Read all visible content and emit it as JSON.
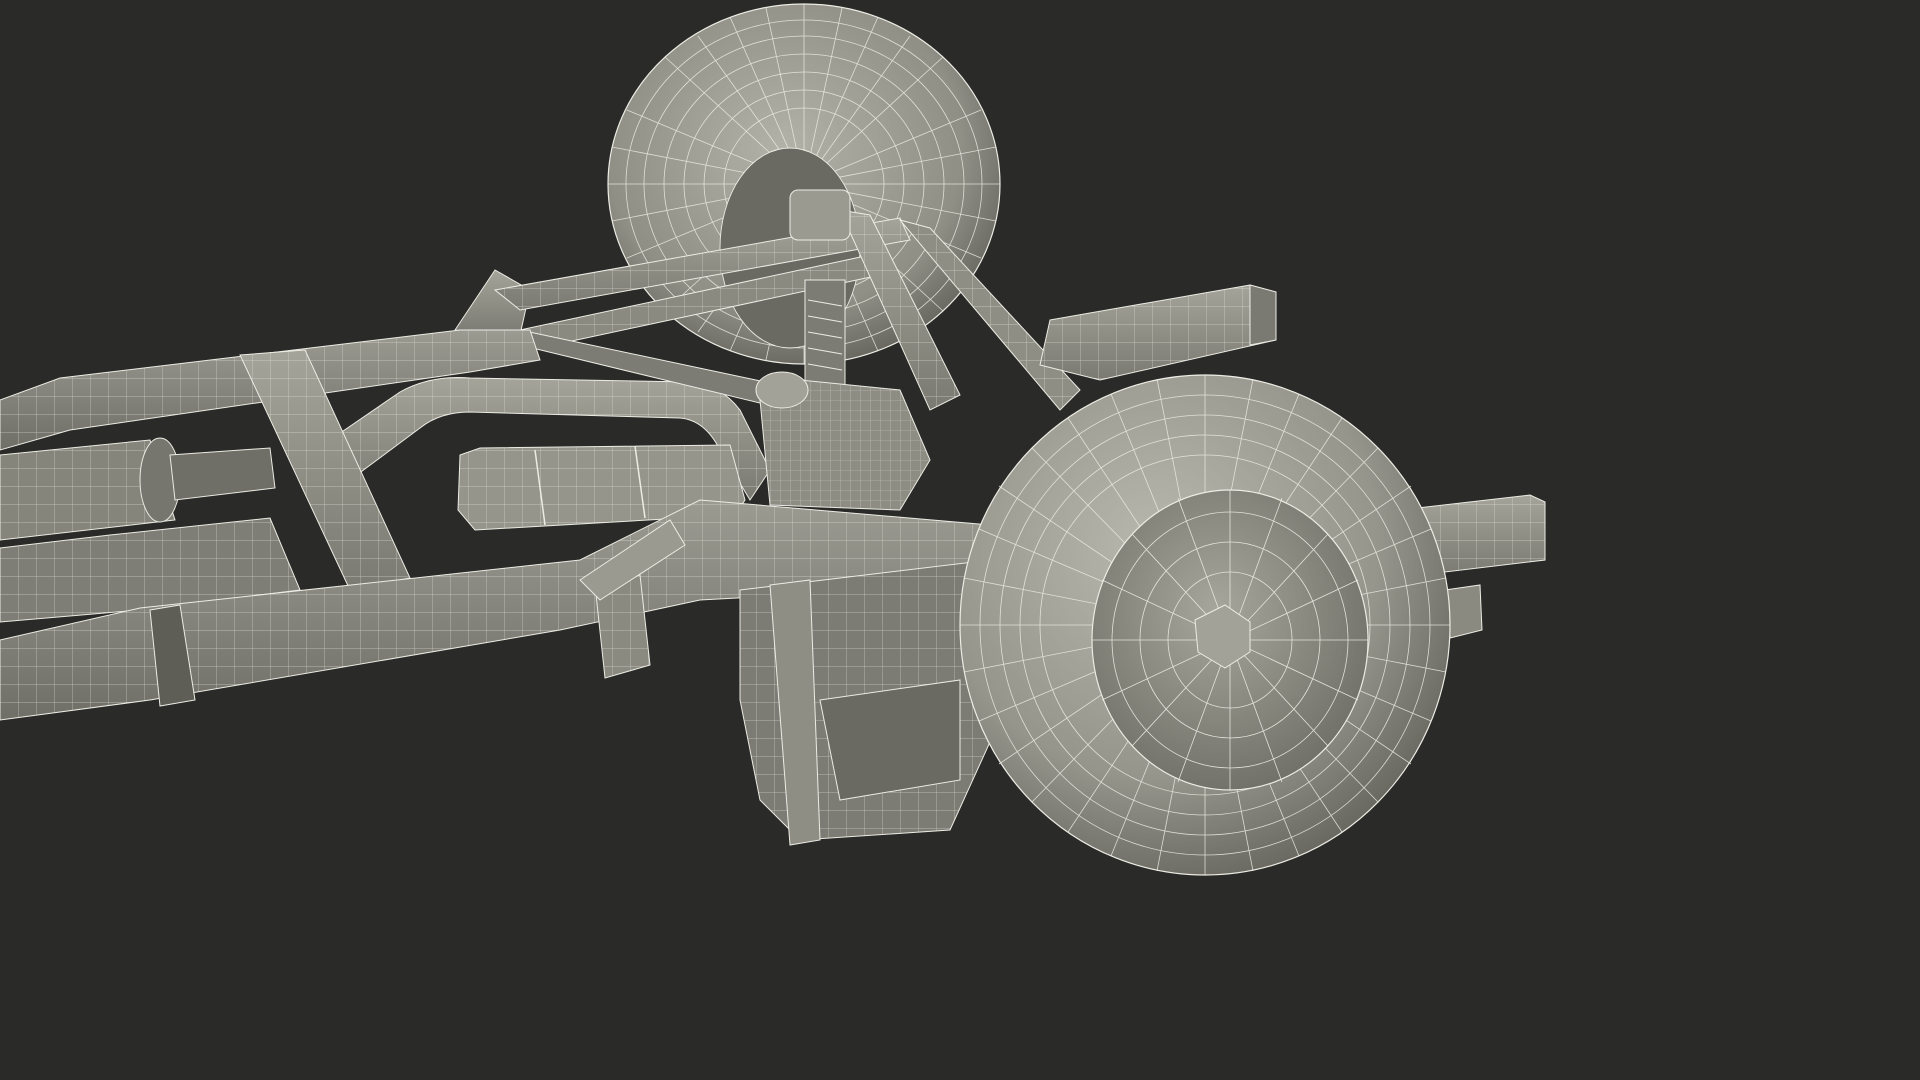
{
  "scene": {
    "subject": "chassis-wireframe-render",
    "colors": {
      "background": "#2a2a28",
      "surface": "#8e8e85",
      "surface_light": "#a9a99f",
      "surface_dark": "#67675f",
      "shadow": "#4c4c46",
      "wire": "#ecece4"
    },
    "icons": [
      "wheel-icon",
      "frame-rail-icon",
      "axle-icon",
      "fuel-tank-icon",
      "suspension-icon"
    ]
  }
}
